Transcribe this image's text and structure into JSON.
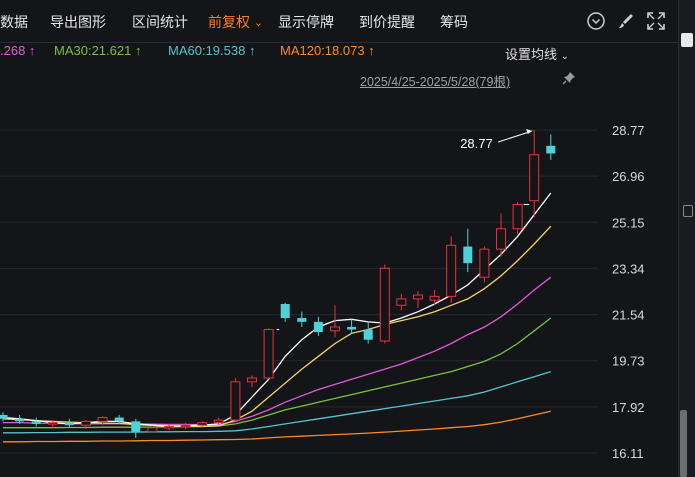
{
  "toolbar": {
    "items": [
      "数据",
      "导出图形",
      "区间统计",
      "前复权",
      "显示停牌",
      "到价提醒",
      "筹码"
    ],
    "active_index": 3,
    "icons": [
      "clock-down-icon",
      "brush-icon",
      "fullscreen-icon"
    ]
  },
  "ma_line": {
    "ma_partial": ".268 ↑",
    "ma30": "MA30:21.621 ↑",
    "ma60": "MA60:19.538 ↑",
    "ma120": "MA120:18.073 ↑"
  },
  "settings_label": "设置均线",
  "date_range": "2025/4/25-2025/5/28(79根)",
  "high_label": "28.77",
  "y_labels": [
    "28.77",
    "26.96",
    "25.15",
    "23.34",
    "21.54",
    "19.73",
    "17.92",
    "16.11"
  ],
  "colors": {
    "up": "#e8333a",
    "down": "#4fd1d9",
    "ma5": "#ffffff",
    "ma10": "#f3d56a",
    "ma20": "#e05ad7",
    "ma30": "#7bc13b",
    "ma60": "#55c4cf",
    "ma120": "#ff8a1f",
    "active": "#ff7a22"
  },
  "chart_data": {
    "type": "candlestick",
    "y_range": [
      16.11,
      28.77
    ],
    "candles": [
      {
        "o": 17.6,
        "h": 17.7,
        "l": 17.35,
        "c": 17.45
      },
      {
        "o": 17.45,
        "h": 17.6,
        "l": 17.25,
        "c": 17.35
      },
      {
        "o": 17.35,
        "h": 17.5,
        "l": 17.15,
        "c": 17.25
      },
      {
        "o": 17.25,
        "h": 17.4,
        "l": 17.1,
        "c": 17.3
      },
      {
        "o": 17.3,
        "h": 17.45,
        "l": 17.1,
        "c": 17.2
      },
      {
        "o": 17.2,
        "h": 17.4,
        "l": 17.05,
        "c": 17.35
      },
      {
        "o": 17.35,
        "h": 17.55,
        "l": 17.2,
        "c": 17.5
      },
      {
        "o": 17.5,
        "h": 17.6,
        "l": 17.25,
        "c": 17.35
      },
      {
        "o": 17.35,
        "h": 17.45,
        "l": 16.7,
        "c": 16.95
      },
      {
        "o": 16.95,
        "h": 17.15,
        "l": 16.9,
        "c": 17.1
      },
      {
        "o": 17.1,
        "h": 17.25,
        "l": 17.0,
        "c": 17.15
      },
      {
        "o": 17.15,
        "h": 17.3,
        "l": 17.05,
        "c": 17.2
      },
      {
        "o": 17.2,
        "h": 17.35,
        "l": 17.1,
        "c": 17.3
      },
      {
        "o": 17.3,
        "h": 17.5,
        "l": 17.2,
        "c": 17.4
      },
      {
        "o": 17.4,
        "h": 19.05,
        "l": 17.35,
        "c": 18.9
      },
      {
        "o": 18.9,
        "h": 19.15,
        "l": 18.7,
        "c": 19.05
      },
      {
        "o": 19.05,
        "h": 21.0,
        "l": 19.0,
        "c": 20.95
      },
      {
        "o": 21.95,
        "h": 22.0,
        "l": 21.25,
        "c": 21.4
      },
      {
        "o": 21.4,
        "h": 21.65,
        "l": 21.05,
        "c": 21.25
      },
      {
        "o": 21.25,
        "h": 21.45,
        "l": 20.7,
        "c": 20.85
      },
      {
        "o": 20.9,
        "h": 21.9,
        "l": 20.65,
        "c": 21.05
      },
      {
        "o": 21.05,
        "h": 21.35,
        "l": 20.8,
        "c": 20.95
      },
      {
        "o": 20.95,
        "h": 21.25,
        "l": 20.4,
        "c": 20.55
      },
      {
        "o": 20.5,
        "h": 23.5,
        "l": 20.4,
        "c": 23.35
      },
      {
        "o": 21.9,
        "h": 22.35,
        "l": 21.7,
        "c": 22.15
      },
      {
        "o": 22.15,
        "h": 22.45,
        "l": 21.8,
        "c": 22.3
      },
      {
        "o": 22.1,
        "h": 22.5,
        "l": 21.9,
        "c": 22.25
      },
      {
        "o": 22.25,
        "h": 24.6,
        "l": 22.0,
        "c": 24.25
      },
      {
        "o": 24.2,
        "h": 24.9,
        "l": 23.2,
        "c": 23.55
      },
      {
        "o": 23.0,
        "h": 24.2,
        "l": 22.8,
        "c": 24.1
      },
      {
        "o": 24.1,
        "h": 25.5,
        "l": 23.8,
        "c": 24.9
      },
      {
        "o": 24.9,
        "h": 25.95,
        "l": 24.7,
        "c": 25.85
      },
      {
        "o": 26.0,
        "h": 28.77,
        "l": 25.35,
        "c": 27.8
      },
      {
        "o": 28.15,
        "h": 28.6,
        "l": 27.6,
        "c": 27.85
      }
    ],
    "ma_series": [
      {
        "key": "ma120",
        "values": [
          16.55,
          16.55,
          16.56,
          16.56,
          16.57,
          16.57,
          16.58,
          16.58,
          16.59,
          16.6,
          16.6,
          16.61,
          16.62,
          16.63,
          16.64,
          16.66,
          16.7,
          16.74,
          16.77,
          16.8,
          16.83,
          16.86,
          16.89,
          16.93,
          16.97,
          17.01,
          17.05,
          17.1,
          17.15,
          17.22,
          17.32,
          17.45,
          17.6,
          17.75
        ]
      },
      {
        "key": "ma60",
        "values": [
          16.9,
          16.9,
          16.91,
          16.91,
          16.92,
          16.92,
          16.93,
          16.93,
          16.93,
          16.94,
          16.94,
          16.95,
          16.95,
          16.96,
          16.98,
          17.05,
          17.15,
          17.25,
          17.35,
          17.45,
          17.55,
          17.65,
          17.75,
          17.85,
          17.95,
          18.05,
          18.15,
          18.25,
          18.35,
          18.5,
          18.7,
          18.9,
          19.1,
          19.3
        ]
      },
      {
        "key": "ma30",
        "values": [
          17.1,
          17.1,
          17.1,
          17.1,
          17.11,
          17.11,
          17.12,
          17.12,
          17.12,
          17.13,
          17.13,
          17.14,
          17.15,
          17.17,
          17.25,
          17.4,
          17.6,
          17.8,
          17.95,
          18.1,
          18.25,
          18.4,
          18.55,
          18.7,
          18.85,
          19.0,
          19.15,
          19.3,
          19.5,
          19.7,
          20.0,
          20.4,
          20.9,
          21.4
        ]
      },
      {
        "key": "ma20",
        "values": [
          17.3,
          17.3,
          17.28,
          17.27,
          17.26,
          17.25,
          17.26,
          17.26,
          17.25,
          17.24,
          17.23,
          17.23,
          17.22,
          17.22,
          17.35,
          17.55,
          17.8,
          18.1,
          18.35,
          18.6,
          18.8,
          19.0,
          19.2,
          19.4,
          19.6,
          19.85,
          20.1,
          20.4,
          20.75,
          21.05,
          21.45,
          21.95,
          22.5,
          23.0
        ]
      },
      {
        "key": "ma10",
        "values": [
          17.45,
          17.42,
          17.38,
          17.35,
          17.32,
          17.3,
          17.28,
          17.27,
          17.22,
          17.2,
          17.18,
          17.16,
          17.15,
          17.18,
          17.4,
          17.75,
          18.3,
          18.85,
          19.4,
          19.9,
          20.4,
          20.8,
          20.95,
          21.15,
          21.3,
          21.45,
          21.65,
          21.9,
          22.15,
          22.55,
          23.05,
          23.65,
          24.3,
          25.0
        ]
      },
      {
        "key": "ma5",
        "values": [
          17.5,
          17.45,
          17.38,
          17.3,
          17.25,
          17.3,
          17.35,
          17.35,
          17.25,
          17.2,
          17.15,
          17.18,
          17.2,
          17.25,
          17.6,
          18.3,
          19.0,
          19.9,
          20.55,
          21.05,
          21.3,
          21.35,
          21.25,
          21.2,
          21.4,
          21.65,
          21.95,
          22.3,
          22.7,
          23.3,
          23.9,
          24.6,
          25.45,
          26.3
        ]
      }
    ]
  }
}
